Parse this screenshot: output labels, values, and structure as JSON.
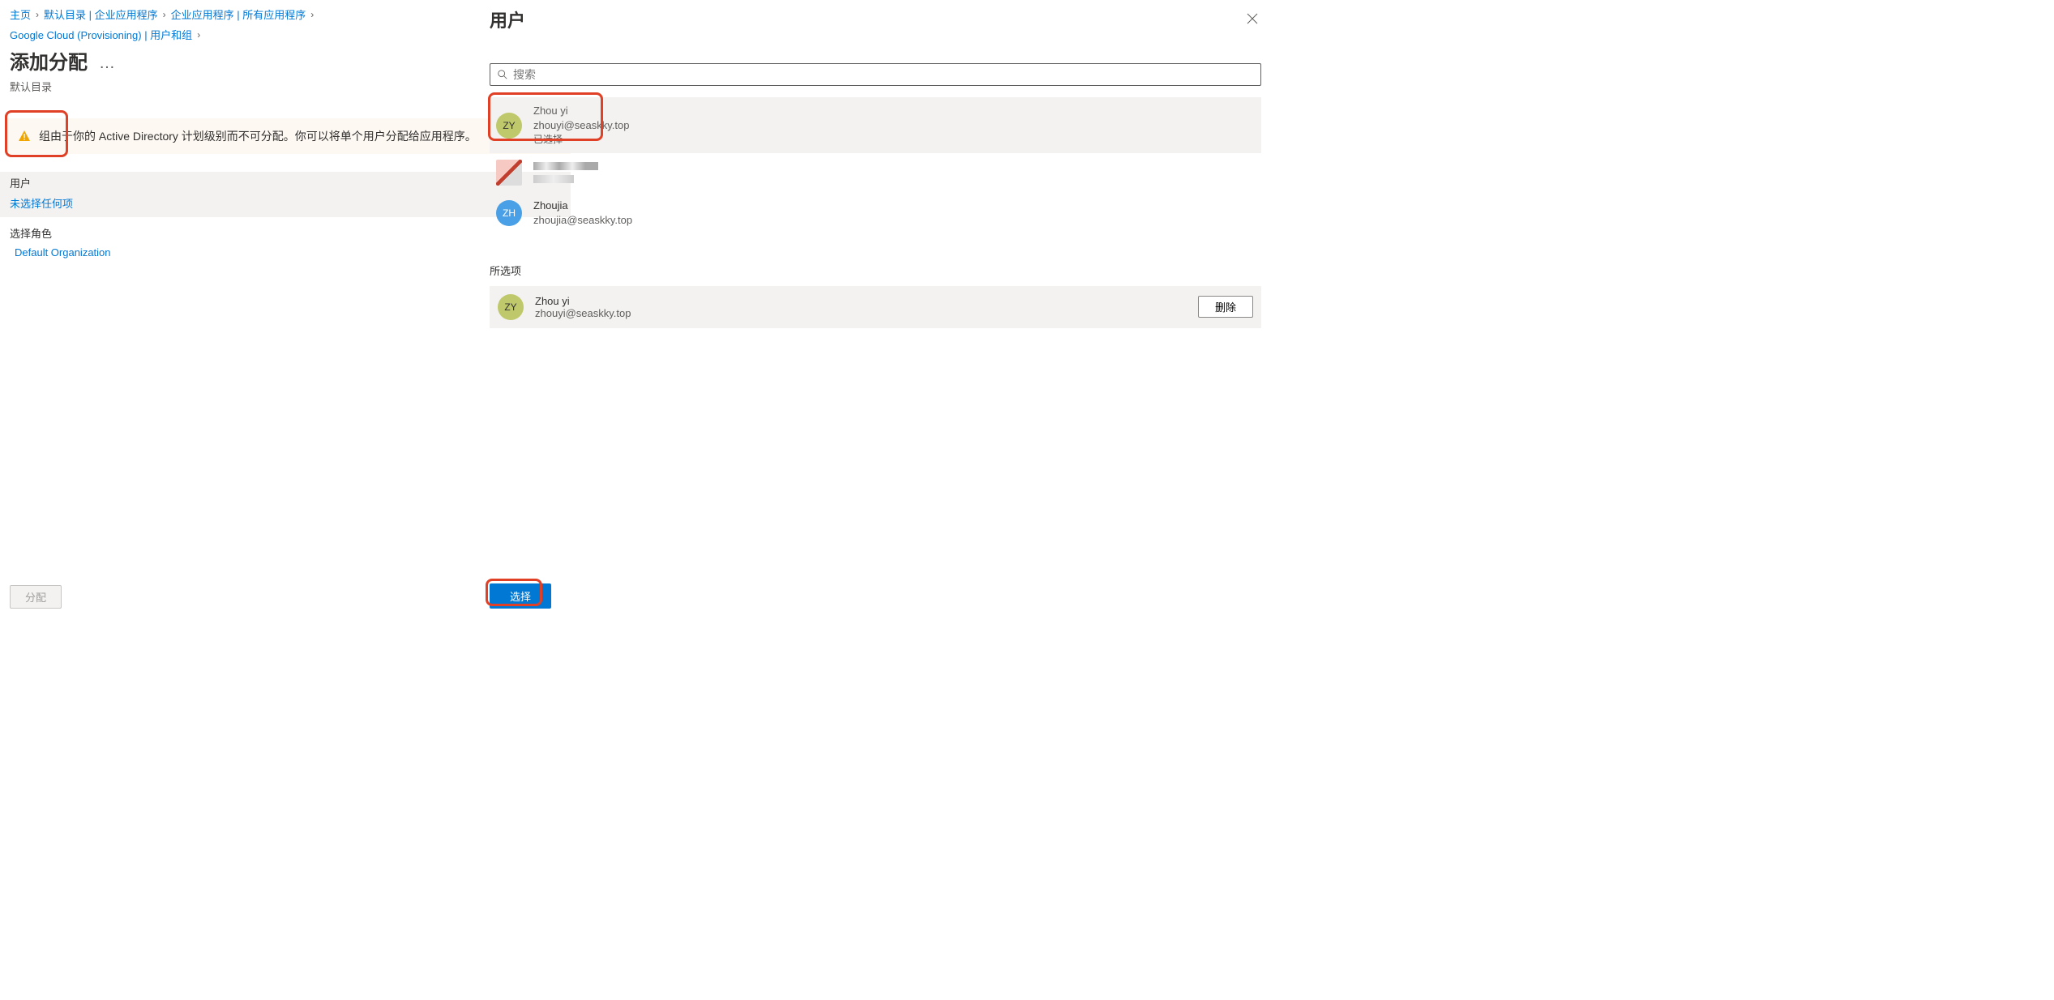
{
  "breadcrumb": {
    "items": [
      {
        "label": "主页"
      },
      {
        "label": "默认目录 | 企业应用程序"
      },
      {
        "label": "企业应用程序 | 所有应用程序"
      },
      {
        "label": "Google Cloud (Provisioning) | 用户和组"
      }
    ],
    "separator": "›"
  },
  "page": {
    "title": "添加分配",
    "subtitle": "默认目录",
    "ellipsis": "…"
  },
  "banner": {
    "text": "组由于你的 Active Directory 计划级别而不可分配。你可以将单个用户分配给应用程序。"
  },
  "assignment": {
    "users_label": "用户",
    "none_selected": "未选择任何项",
    "role_label": "选择角色",
    "role_value": "Default Organization"
  },
  "footer": {
    "assign": "分配"
  },
  "panel": {
    "title": "用户",
    "search_placeholder": "搜索",
    "selected_label": "所选项",
    "select_button": "选择",
    "remove_button": "删除"
  },
  "users": [
    {
      "initials": "ZY",
      "name": "Zhou yi",
      "email": "zhouyi@seaskky.top",
      "status": "已选择",
      "avatar_class": "olive"
    },
    {
      "initials": "ZH",
      "name": "Zhoujia",
      "email": "zhoujia@seaskky.top",
      "status": "",
      "avatar_class": "blue"
    }
  ],
  "selected_users": [
    {
      "initials": "ZY",
      "name": "Zhou yi",
      "email": "zhouyi@seaskky.top",
      "avatar_class": "olive"
    }
  ]
}
